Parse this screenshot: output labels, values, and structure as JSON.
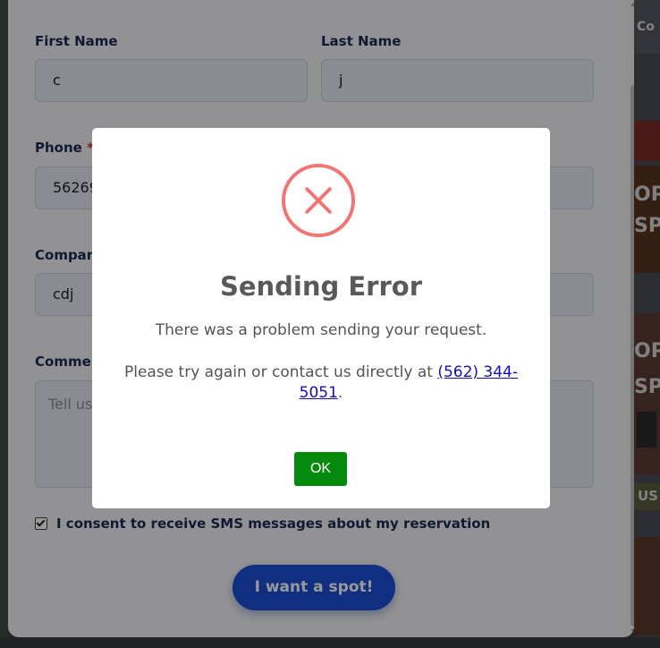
{
  "form": {
    "first_name_label": "First Name",
    "first_name_value": "c",
    "last_name_label": "Last Name",
    "last_name_value": "j",
    "phone_label": "Phone",
    "phone_required_mark": "*",
    "phone_value": "56269",
    "company_label": "Compar",
    "company_value": "cdj",
    "comments_label": "Comme",
    "comments_placeholder": "Tell us",
    "consent_label": "I consent to receive SMS messages about my reservation",
    "submit_label": "I want a spot!"
  },
  "background": {
    "right_texts": [
      "Co",
      "OP",
      "SP",
      "OP",
      "SP",
      "US"
    ]
  },
  "dialog": {
    "title": "Sending Error",
    "message": "There was a problem sending your request.",
    "contact_prefix": "Please try again or contact us directly at ",
    "phone_link": "(562) 344-5051",
    "contact_suffix": ".",
    "ok_label": "OK"
  },
  "colors": {
    "error_icon": "#f27474",
    "ok_button": "#068a0e",
    "submit_button": "#1b4fd8",
    "label_text": "#1b2a55"
  }
}
